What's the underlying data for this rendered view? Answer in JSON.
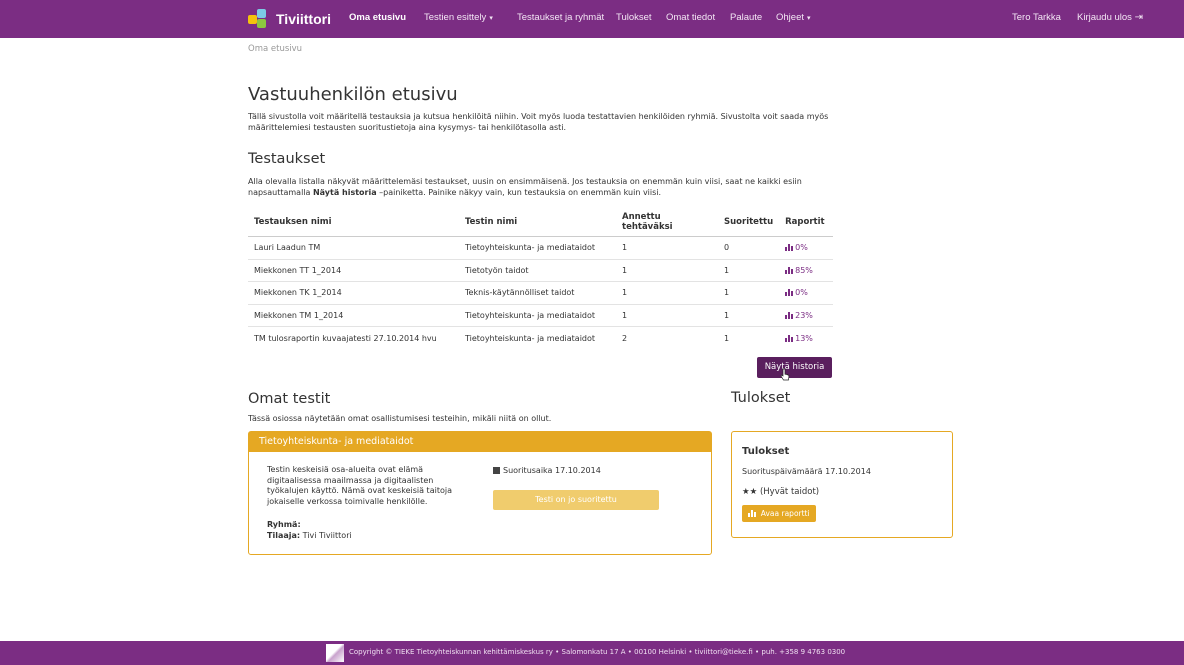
{
  "nav": {
    "brand": "Tiviittori",
    "items": [
      {
        "label": "Oma etusivu",
        "active": true
      },
      {
        "label": "Testien esittely",
        "dropdown": true
      },
      {
        "label": "Testaukset ja ryhmät"
      },
      {
        "label": "Tulokset"
      },
      {
        "label": "Omat tiedot"
      },
      {
        "label": "Palaute"
      },
      {
        "label": "Ohjeet",
        "dropdown": true
      }
    ],
    "user": "Tero Tarkka",
    "logout": "Kirjaudu ulos",
    "logout_icon": "logout-icon",
    "bg_color": "#7b2d83"
  },
  "breadcrumb": "Oma etusivu",
  "page": {
    "title": "Vastuuhenkilön etusivu",
    "intro": "Tällä sivustolla voit määritellä testauksia ja kutsua henkilöitä niihin. Voit myös luoda testattavien henkilöiden ryhmiä. Sivustolta voit saada myös määrittelemiesi testausten suoritustietoja aina kysymys- tai henkilötasolla asti."
  },
  "testaukset": {
    "heading": "Testaukset",
    "intro_part1": "Alla olevalla listalla näkyvät määrittelemäsi testaukset, uusin on ensimmäisenä. Jos testauksia on enemmän kuin viisi, saat ne kaikki esiin napsauttamalla ",
    "intro_bold": "Näytä historia",
    "intro_part2": " –painiketta. Painike näkyy vain, kun testauksia on enemmän kuin viisi.",
    "columns": [
      "Testauksen nimi",
      "Testin nimi",
      "Annettu tehtäväksi",
      "Suoritettu",
      "Raportit"
    ],
    "rows": [
      {
        "name": "Lauri Laadun TM",
        "test": "Tietoyhteiskunta- ja mediataidot",
        "assigned": "1",
        "done": "0",
        "report": "0%"
      },
      {
        "name": "Miekkonen TT 1_2014",
        "test": "Tietotyön taidot",
        "assigned": "1",
        "done": "1",
        "report": "85%"
      },
      {
        "name": "Miekkonen TK 1_2014",
        "test": "Teknis-käytännölliset taidot",
        "assigned": "1",
        "done": "1",
        "report": "0%"
      },
      {
        "name": "Miekkonen TM 1_2014",
        "test": "Tietoyhteiskunta- ja mediataidot",
        "assigned": "1",
        "done": "1",
        "report": "23%"
      },
      {
        "name": "TM tulosraportin kuvaajatesti 27.10.2014 hvu",
        "test": "Tietoyhteiskunta- ja mediataidot",
        "assigned": "2",
        "done": "1",
        "report": "13%"
      }
    ],
    "history_button": "Näytä historia"
  },
  "omat_testit": {
    "heading": "Omat testit",
    "intro": "Tässä osiossa näytetään omat osallistumisesi testeihin, mikäli niitä on ollut.",
    "panel": {
      "title": "Tietoyhteiskunta- ja mediataidot",
      "description": "Testin keskeisiä osa-alueita ovat elämä digitaalisessa maailmassa ja digitaalisten työkalujen käyttö. Nämä ovat keskeisiä taitoja jokaiselle verkossa toimivalle henkilölle.",
      "group_label": "Ryhmä:",
      "group_value": "",
      "orderer_label": "Tilaaja:",
      "orderer_value": "Tivi Tiviittori",
      "date": "Suoritusaika 17.10.2014",
      "done_button": "Testi on jo suoritettu",
      "accent": "#e5a823"
    }
  },
  "tulokset": {
    "heading": "Tulokset",
    "card_title": "Tulokset",
    "date": "Suorituspäivämäärä 17.10.2014",
    "stars": "★★",
    "stars_label": "(Hyvät taidot)",
    "report_button": "Avaa raportti"
  },
  "footer": {
    "text": "Copyright © TIEKE Tietoyhteiskunnan kehittämiskeskus ry • Salomonkatu 17 A • 00100 Helsinki • tiviittori@tieke.fi • puh. +358 9 4763 0300"
  }
}
